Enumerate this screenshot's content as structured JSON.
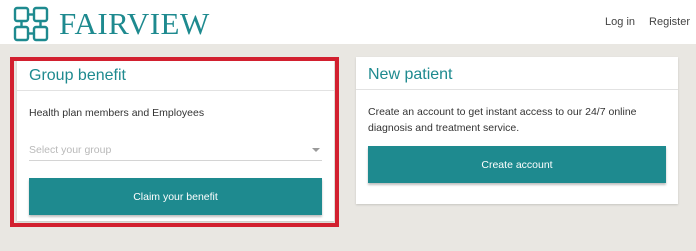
{
  "header": {
    "logo_text": "FAIRVIEW",
    "logo_icon": "fairview-logo-icon",
    "nav": {
      "login": "Log in",
      "register": "Register"
    }
  },
  "group_card": {
    "title": "Group benefit",
    "description": "Health plan members and Employees",
    "select_placeholder": "Select your group",
    "button": "Claim your benefit"
  },
  "new_patient_card": {
    "title": "New patient",
    "description": "Create an account to get instant access to our 24/7 online diagnosis and treatment service.",
    "button": "Create account"
  },
  "colors": {
    "brand_teal": "#1e8a8f",
    "highlight_red": "#d2202f",
    "page_background": "#e9e7e2"
  }
}
